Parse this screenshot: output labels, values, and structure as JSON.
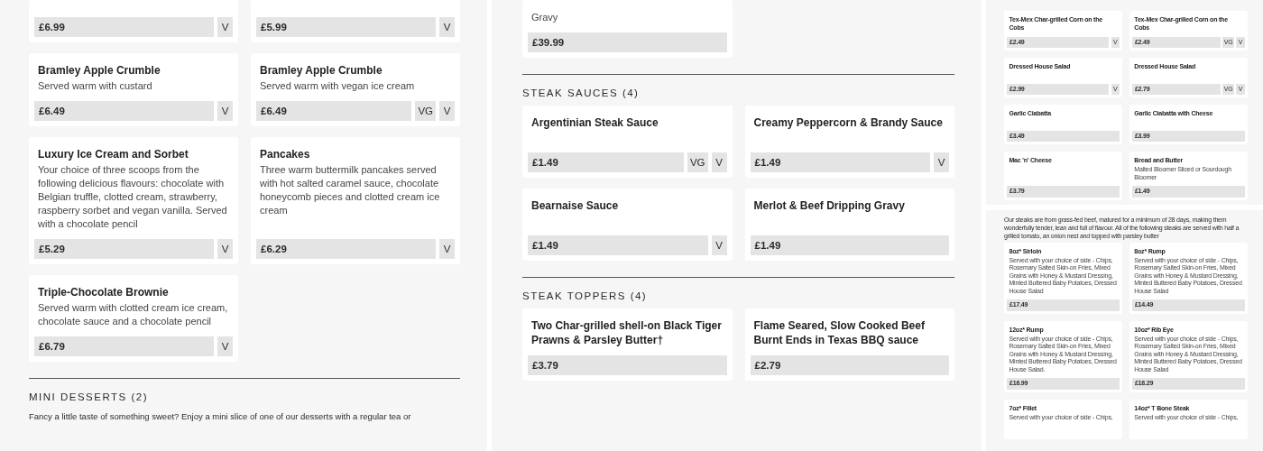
{
  "panels": [
    {
      "kind": "regular",
      "blocks": [
        {
          "kind": "cards",
          "cards": [
            {
              "price": "£6.99",
              "tags": [
                "V"
              ]
            },
            {
              "price": "£5.99",
              "tags": [
                "V"
              ]
            },
            {
              "name": "Bramley Apple Crumble",
              "description": "Served warm with custard",
              "price": "£6.49",
              "tags": [
                "V"
              ]
            },
            {
              "name": "Bramley Apple Crumble",
              "description": "Served warm with vegan ice cream",
              "price": "£6.49",
              "tags": [
                "VG",
                "V"
              ]
            },
            {
              "name": "Luxury Ice Cream and Sorbet",
              "description": "Your choice of three scoops from the following delicious flavours: chocolate with Belgian truffle, clotted cream, strawberry, raspberry sorbet and vegan vanilla. Served with a chocolate pencil",
              "price": "£5.29",
              "tags": [
                "V"
              ]
            },
            {
              "name": "Pancakes",
              "description": "Three warm buttermilk pancakes served with hot salted caramel sauce, chocolate honeycomb pieces and clotted cream ice cream",
              "price": "£6.29",
              "tags": [
                "V"
              ]
            },
            {
              "name": "Triple-Chocolate Brownie",
              "description": "Served warm with clotted cream ice cream, chocolate sauce and a chocolate pencil",
              "price": "£6.79",
              "tags": [
                "V"
              ]
            }
          ]
        },
        {
          "kind": "section",
          "title": "MINI DESSERTS (2)"
        },
        {
          "kind": "intro",
          "text": "Fancy a little taste of something sweet? Enjoy a mini slice of one of our desserts with a regular tea or"
        }
      ]
    },
    {
      "kind": "regular",
      "blocks": [
        {
          "kind": "cards",
          "cards": [
            {
              "description": "Gravy",
              "price": "£39.99"
            }
          ]
        },
        {
          "kind": "section",
          "title": "STEAK SAUCES (4)"
        },
        {
          "kind": "cards",
          "cards": [
            {
              "name": "Argentinian Steak Sauce",
              "price": "£1.49",
              "tags": [
                "VG",
                "V"
              ]
            },
            {
              "name": "Creamy Peppercorn & Brandy Sauce",
              "price": "£1.49",
              "tags": [
                "V"
              ]
            },
            {
              "name": "Bearnaise Sauce",
              "price": "£1.49",
              "tags": [
                "V"
              ]
            },
            {
              "name": "Merlot & Beef Dripping Gravy",
              "price": "£1.49"
            }
          ]
        },
        {
          "kind": "section",
          "title": "STEAK TOPPERS (4)"
        },
        {
          "kind": "cards",
          "cards": [
            {
              "name": "Two Char-grilled shell-on Black Tiger Prawns & Parsley Butter†",
              "price": "£3.79"
            },
            {
              "name": "Flame Seared, Slow Cooked Beef Burnt Ends in Texas BBQ sauce",
              "price": "£2.79"
            }
          ]
        }
      ]
    },
    {
      "kind": "compact",
      "blocks": [
        {
          "kind": "cards",
          "cards": [
            {
              "name": "Tex-Mex Char-grilled Corn on the Cobs",
              "price": "£2.49",
              "tags": [
                "V"
              ]
            },
            {
              "name": "Tex-Mex Char-grilled Corn on the Cobs",
              "price": "£2.49",
              "tags": [
                "VG",
                "V"
              ]
            },
            {
              "name": "Dressed House Salad",
              "price": "£2.99",
              "tags": [
                "V"
              ]
            },
            {
              "name": "Dressed House Salad",
              "price": "£2.79",
              "tags": [
                "VG",
                "V"
              ]
            },
            {
              "name": "Garlic Ciabatta",
              "price": "£3.49"
            },
            {
              "name": "Garlic Ciabatta with Cheese",
              "price": "£3.99"
            },
            {
              "name": "Mac 'n' Cheese",
              "price": "£3.79"
            },
            {
              "name": "Bread and Butter",
              "description": "Malted Bloomer Sliced or Sourdough Bloomer",
              "price": "£1.49"
            }
          ]
        },
        {
          "kind": "break"
        },
        {
          "kind": "intro",
          "text": "Our steaks are from grass-fed beef, matured for a minimum of 28 days, making them wonderfully tender, lean and full of flavour. All of the following steaks are served with half a grilled tomato, an onion nest and topped with parsley butter"
        },
        {
          "kind": "cards",
          "cards": [
            {
              "name": "8oz* Sirloin",
              "description": "Served with your choice of side - Chips, Rosemary Salted Skin-on Fries, Mixed Grains with Honey & Mustard Dressing, Minted Buttered Baby Potatoes, Dressed House Salad",
              "price": "£17.49"
            },
            {
              "name": "8oz* Rump",
              "description": "Served with your choice of side - Chips, Rosemary Salted Skin-on Fries, Mixed Grains with Honey & Mustard Dressing, Minted Buttered Baby Potatoes, Dressed House Salad",
              "price": "£14.49"
            },
            {
              "name": "12oz* Rump",
              "description": "Served with your choice of side - Chips, Rosemary Salted Skin-on Fries, Mixed Grains with Honey & Mustard Dressing, Minted Buttered Baby Potatoes, Dressed House Salad.",
              "price": "£16.99"
            },
            {
              "name": "10oz* Rib Eye",
              "description": "Served with your choice of side - Chips, Rosemary Salted Skin-on Fries, Mixed Grains with Honey & Mustard Dressing, Minted Buttered Baby Potatoes, Dressed House Salad",
              "price": "£18.29"
            },
            {
              "name": "7oz* Fillet",
              "description": "Served with your choice of side - Chips,"
            },
            {
              "name": "14oz* T Bone Steak",
              "description": "Served with your choice of side - Chips,"
            }
          ]
        }
      ]
    }
  ]
}
